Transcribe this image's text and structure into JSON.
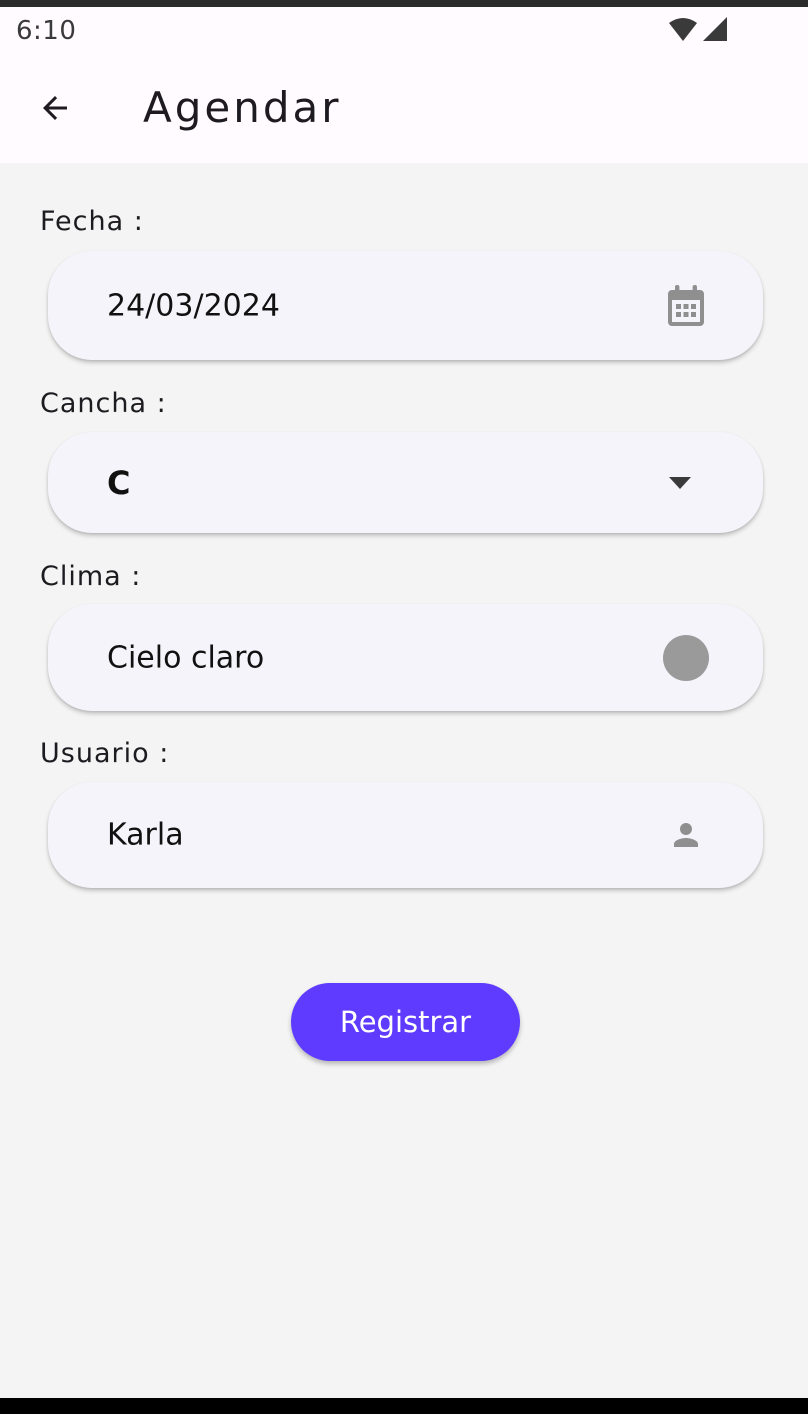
{
  "status_bar": {
    "time": "6:10",
    "icons": [
      "wifi-icon",
      "cell-signal-icon"
    ]
  },
  "app_bar": {
    "back_icon": "arrow-back-icon",
    "title": "Agendar"
  },
  "form": {
    "fecha": {
      "label": "Fecha :",
      "value": "24/03/2024",
      "icon": "calendar-icon"
    },
    "cancha": {
      "label": "Cancha :",
      "value": "C",
      "icon": "dropdown-arrow-icon"
    },
    "clima": {
      "label": "Clima :",
      "value": "Cielo claro",
      "icon": "weather-circle-icon"
    },
    "usuario": {
      "label": "Usuario :",
      "value": "Karla",
      "icon": "person-icon"
    }
  },
  "register_label": "Registrar",
  "colors": {
    "accent": "#5e3bff",
    "card_background": "#f5f4fb",
    "page_background": "#f3f4f3",
    "icon_gray": "#8f8f8f"
  }
}
